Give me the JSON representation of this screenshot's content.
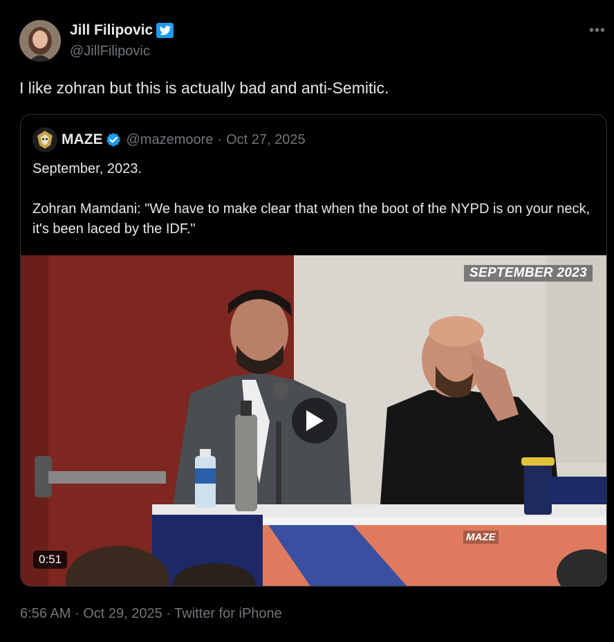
{
  "author": {
    "name": "Jill Filipovic",
    "handle": "@JillFilipovic"
  },
  "tweet": {
    "text": "I like zohran but this is actually bad and anti-Semitic."
  },
  "quoted": {
    "name": "MAZE",
    "handle": "@mazemoore",
    "separator": "·",
    "date": "Oct 27, 2025",
    "text_line1": "September, 2023.",
    "text_line2": "Zohran Mamdani: \"We have to make clear that when the boot of the NYPD is on your neck, it's been laced by the IDF.\"",
    "video": {
      "overlay_title": "SEPTEMBER 2023",
      "duration": "0:51",
      "banner_label": "MAZE"
    }
  },
  "meta": {
    "time": "6:56 AM",
    "separator1": "·",
    "date": "Oct 29, 2025",
    "separator2": "·",
    "source": "Twitter for iPhone"
  },
  "icons": {
    "more": "more-options-icon",
    "verified": "verified-badge-icon",
    "play": "play-icon"
  },
  "colors": {
    "background": "#000000",
    "text": "#e7e9ea",
    "muted": "#71767b",
    "verified_blue": "#1d9bf0",
    "border": "#2f3336"
  }
}
